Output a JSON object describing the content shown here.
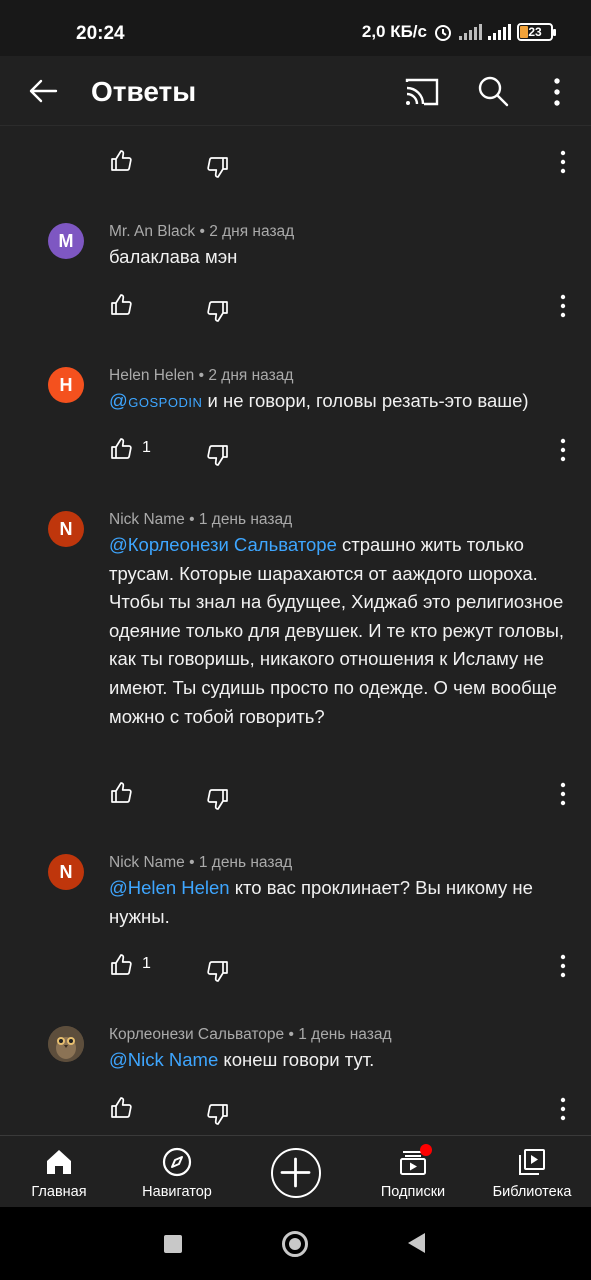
{
  "status_bar": {
    "time": "20:24",
    "network_speed": "2,0 КБ/с",
    "battery": "23"
  },
  "app_bar": {
    "title": "Ответы",
    "back_icon": "arrow-back-icon",
    "cast_icon": "cast-icon",
    "search_icon": "search-icon",
    "more_icon": "more-vert-icon"
  },
  "comments": [
    {
      "author": "",
      "time": "",
      "like_count": "",
      "text": ""
    },
    {
      "author": "Mr. An Black",
      "time": "2 дня назад",
      "avatar_letter": "M",
      "avatar_color": "#7e57c2",
      "text": "балаклава мэн",
      "like_count": ""
    },
    {
      "author": "Helen Helen",
      "time": "2 дня назад",
      "avatar_letter": "H",
      "avatar_color": "#f4511e",
      "mention": "@gospodin",
      "text": " и не говори, головы резать-это ваше)",
      "like_count": "1"
    },
    {
      "author": "Nick Name",
      "time": "1 день назад",
      "avatar_letter": "N",
      "avatar_color": "#bf360c",
      "mention": "@Корлеонези Сальваторе",
      "text": " страшно жить только трусам.  Которые шарахаются  от ааждого шороха. Чтобы ты  знал на будущее,  Хиджаб  это религиозное одеяние только для девушек. И те кто режут головы, как ты говоришь, никакого отношения к Исламу не имеют. Ты  судишь просто по одежде. О чем вообще можно с тобой говорить?",
      "like_count": ""
    },
    {
      "author": "Nick Name",
      "time": "1 день назад",
      "avatar_letter": "N",
      "avatar_color": "#bf360c",
      "mention": "@Helen Helen",
      "text": " кто вас проклинает? Вы никому не нужны.",
      "like_count": "1"
    },
    {
      "author": "Корлеонези Сальваторе",
      "time": "1 день назад",
      "avatar_color": "#5d4e3c",
      "mention": "@Nick Name",
      "text": " конеш говори тут.",
      "like_count": ""
    }
  ],
  "bottom_nav": {
    "home": "Главная",
    "explore": "Навигатор",
    "subscriptions": "Подписки",
    "library": "Библиотека"
  }
}
